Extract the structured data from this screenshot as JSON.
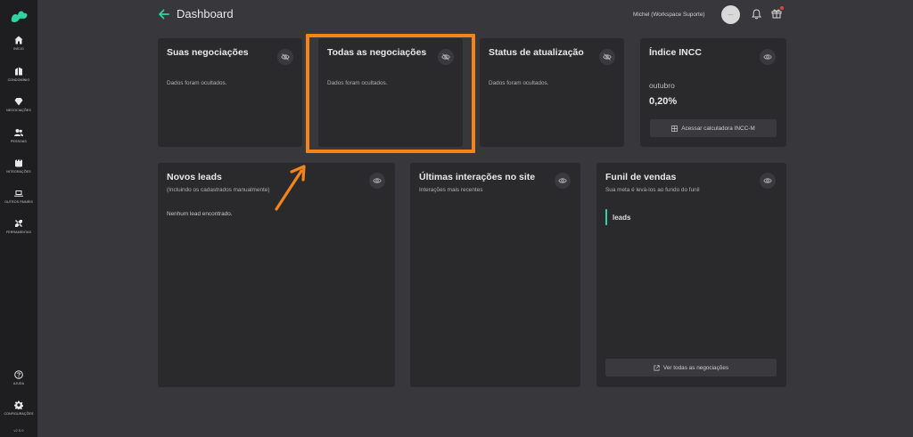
{
  "sidebar": {
    "items": [
      {
        "label": "Início",
        "icon": "home-icon"
      },
      {
        "label": "Condomínio",
        "icon": "building-icon"
      },
      {
        "label": "Negociações",
        "icon": "diamond-icon"
      },
      {
        "label": "Pessoas",
        "icon": "people-icon"
      },
      {
        "label": "Integrações",
        "icon": "integrations-icon"
      },
      {
        "label": "Outros painéis",
        "icon": "laptop-icon"
      },
      {
        "label": "Ferramentas",
        "icon": "tools-icon"
      }
    ],
    "help": {
      "label": "Ajuda",
      "icon": "help-icon"
    },
    "settings": {
      "label": "Configurações",
      "icon": "gear-icon"
    },
    "version": "v2.5.0"
  },
  "header": {
    "title": "Dashboard",
    "user_name": "Michel (Workspace Suporte)",
    "avatar_text": "—"
  },
  "cards": {
    "suas": {
      "title": "Suas negociações",
      "text": "Dados foram ocultados."
    },
    "todas": {
      "title": "Todas as negociações",
      "text": "Dados foram ocultados."
    },
    "status": {
      "title": "Status de atualização",
      "text": "Dados foram ocultados."
    },
    "incc": {
      "title": "Índice INCC",
      "month": "outubro",
      "value": "0,20%",
      "button": "Acessar calculadora INCC-M"
    },
    "leads": {
      "title": "Novos leads",
      "subtitle": "(Incluindo os cadastrados manualmente)",
      "empty": "Nenhum lead encontrado."
    },
    "interacoes": {
      "title": "Últimas interações no site",
      "subtitle": "Interações mais recentes"
    },
    "funil": {
      "title": "Funil de vendas",
      "subtitle": "Sua meta é levá-los ao fundo do funil",
      "stage": "leads",
      "button": "Ver todas as negociações"
    }
  },
  "colors": {
    "accent": "#2bd4a0",
    "highlight": "#f2841a",
    "card_bg": "#2a2a2d",
    "page_bg": "#38383c"
  }
}
